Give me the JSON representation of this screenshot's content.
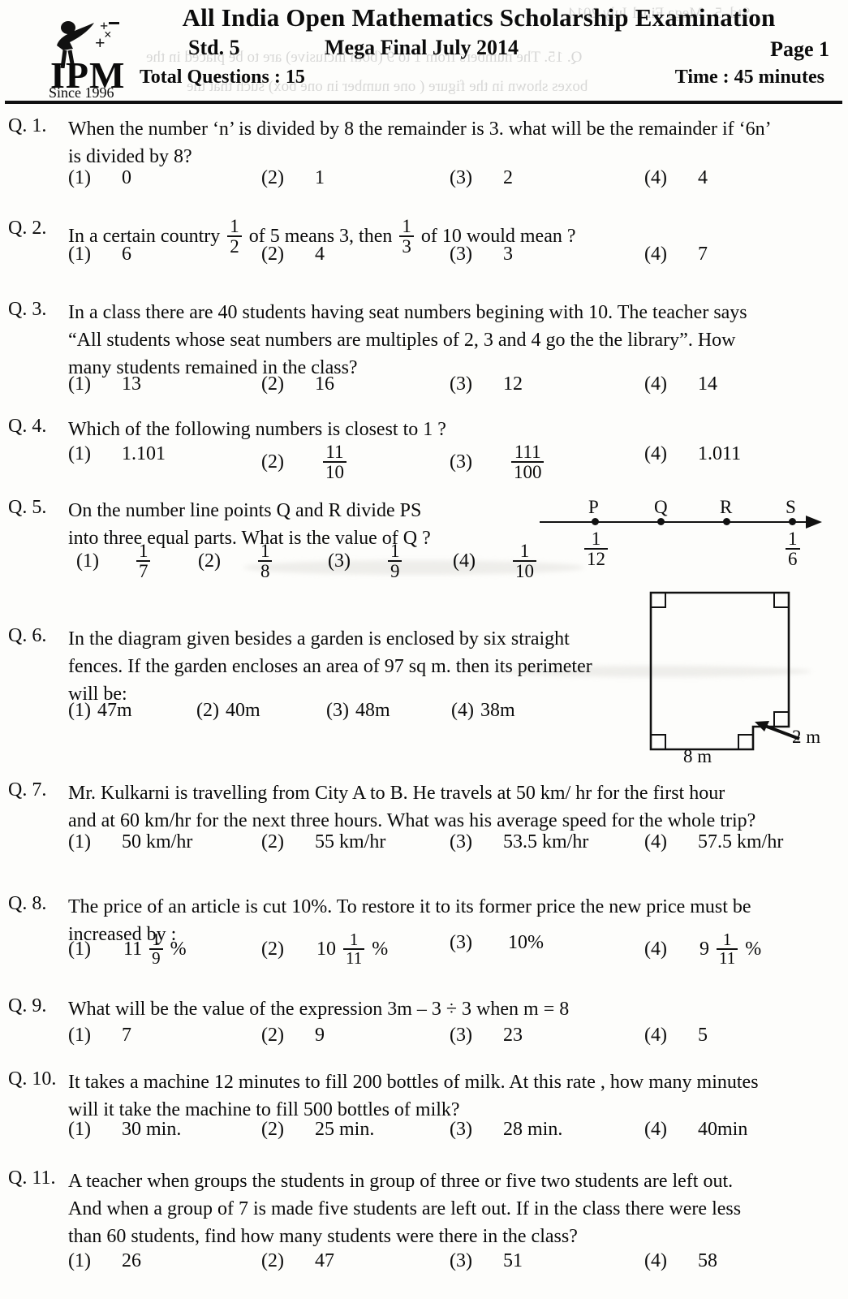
{
  "header": {
    "logo": {
      "text": "IPM",
      "since": "Since 1996",
      "symbols": [
        "+",
        "−",
        "×"
      ]
    },
    "title": "All India Open Mathematics Scholarship Examination",
    "std": "Std. 5",
    "exam": "Mega Final  July 2014",
    "page": "Page 1",
    "total_questions": "Total Questions : 15",
    "time": "Time : 45 minutes"
  },
  "questions": [
    {
      "number": "Q. 1.",
      "lines": [
        "When the number ‘n’ is divided by 8 the remainder is 3. what will be the remainder if ‘6n’",
        "is divided by 8?"
      ],
      "options": [
        {
          "label": "(1)",
          "value": "0"
        },
        {
          "label": "(2)",
          "value": "1"
        },
        {
          "label": "(3)",
          "value": "2"
        },
        {
          "label": "(4)",
          "value": "4"
        }
      ]
    },
    {
      "number": "Q. 2.",
      "text_parts": {
        "a": "In a certain country",
        "frac1": {
          "num": "1",
          "den": "2"
        },
        "b": "of 5 means 3, then",
        "frac2": {
          "num": "1",
          "den": "3"
        },
        "c": "of 10 would mean ?"
      },
      "options": [
        {
          "label": "(1)",
          "value": "6"
        },
        {
          "label": "(2)",
          "value": "4"
        },
        {
          "label": "(3)",
          "value": "3"
        },
        {
          "label": "(4)",
          "value": "7"
        }
      ]
    },
    {
      "number": "Q. 3.",
      "lines": [
        "In a class there are 40 students having seat numbers begining with 10. The teacher says",
        "“All  students whose seat numbers are multiples of 2, 3 and 4 go the the library”. How",
        "many students remained in the class?"
      ],
      "options": [
        {
          "label": "(1)",
          "value": "13"
        },
        {
          "label": "(2)",
          "value": "16"
        },
        {
          "label": "(3)",
          "value": "12"
        },
        {
          "label": "(4)",
          "value": "14"
        }
      ]
    },
    {
      "number": "Q. 4.",
      "lines": [
        "Which of the following numbers is closest to 1 ?"
      ],
      "options": [
        {
          "label": "(1)",
          "value": "1.101"
        },
        {
          "label": "(2)",
          "frac": {
            "num": "11",
            "den": "10"
          }
        },
        {
          "label": "(3)",
          "frac": {
            "num": "111",
            "den": "100"
          }
        },
        {
          "label": "(4)",
          "value": "1.011"
        }
      ]
    },
    {
      "number": "Q. 5.",
      "lines": [
        "On the number line points Q and R divide PS",
        "into three equal parts. What is the value of Q ?"
      ],
      "options": [
        {
          "label": "(1)",
          "frac": {
            "num": "1",
            "den": "7"
          }
        },
        {
          "label": "(2)",
          "frac": {
            "num": "1",
            "den": "8"
          }
        },
        {
          "label": "(3)",
          "frac": {
            "num": "1",
            "den": "9"
          }
        },
        {
          "label": "(4)",
          "frac": {
            "num": "1",
            "den": "10"
          }
        }
      ],
      "diagram": {
        "type": "number-line",
        "points": [
          {
            "name": "P",
            "value_num": "1",
            "value_den": "12"
          },
          {
            "name": "Q",
            "value_num": "",
            "value_den": ""
          },
          {
            "name": "R",
            "value_num": "",
            "value_den": ""
          },
          {
            "name": "S",
            "value_num": "1",
            "value_den": "6"
          }
        ]
      }
    },
    {
      "number": "Q. 6.",
      "lines": [
        "In the diagram given besides a garden is enclosed by six straight",
        "fences. If the garden encloses an area of 97 sq m. then its perimeter",
        "will be:"
      ],
      "options": [
        {
          "label": "(1)",
          "value": "47m"
        },
        {
          "label": "(2)",
          "value": "40m"
        },
        {
          "label": "(3)",
          "value": "48m"
        },
        {
          "label": "(4)",
          "value": "38m"
        }
      ],
      "diagram": {
        "type": "polygon-garden",
        "labels": {
          "notch": "2 m",
          "bottom": "8 m"
        }
      }
    },
    {
      "number": "Q. 7.",
      "lines": [
        "Mr. Kulkarni is travelling from City A to B. He travels at 50 km/ hr for the first hour",
        "and at 60 km/hr for the next three hours. What was his average speed for the whole trip?"
      ],
      "options": [
        {
          "label": "(1)",
          "value": "50 km/hr"
        },
        {
          "label": "(2)",
          "value": "55 km/hr"
        },
        {
          "label": "(3)",
          "value": "53.5 km/hr"
        },
        {
          "label": "(4)",
          "value": "57.5 km/hr"
        }
      ]
    },
    {
      "number": "Q. 8.",
      "lines": [
        "The price of an article is cut 10%. To restore it to its former price the new price must be",
        "increased by :"
      ],
      "options": [
        {
          "label": "(1)",
          "whole": "11",
          "frac": {
            "num": "1",
            "den": "9"
          },
          "suffix": "%"
        },
        {
          "label": "(2)",
          "whole": "10",
          "frac": {
            "num": "1",
            "den": "11"
          },
          "suffix": "%"
        },
        {
          "label": "(3)",
          "value": "10%"
        },
        {
          "label": "(4)",
          "whole": "9",
          "frac": {
            "num": "1",
            "den": "11"
          },
          "suffix": "%"
        }
      ]
    },
    {
      "number": "Q. 9.",
      "lines": [
        "What will be the value of the expression 3m – 3 ÷  3 when m = 8"
      ],
      "options": [
        {
          "label": "(1)",
          "value": "7"
        },
        {
          "label": "(2)",
          "value": "9"
        },
        {
          "label": "(3)",
          "value": "23"
        },
        {
          "label": "(4)",
          "value": "5"
        }
      ]
    },
    {
      "number": "Q. 10.",
      "lines": [
        "It takes a machine 12 minutes to fill 200 bottles of milk. At this rate , how many minutes",
        "will it take the machine to fill 500 bottles of milk?"
      ],
      "options": [
        {
          "label": "(1)",
          "value": "30 min."
        },
        {
          "label": "(2)",
          "value": "25 min."
        },
        {
          "label": "(3)",
          "value": "28 min."
        },
        {
          "label": "(4)",
          "value": "40min"
        }
      ]
    },
    {
      "number": "Q. 11.",
      "lines": [
        "A teacher when groups the students in group of three or five two students are left out.",
        "And when a group of 7 is made five students are left out. If in the class there were less",
        "than 60 students, find how many students were there in the class?"
      ],
      "options": [
        {
          "label": "(1)",
          "value": "26"
        },
        {
          "label": "(2)",
          "value": "47"
        },
        {
          "label": "(3)",
          "value": "51"
        },
        {
          "label": "(4)",
          "value": "58"
        }
      ]
    }
  ]
}
